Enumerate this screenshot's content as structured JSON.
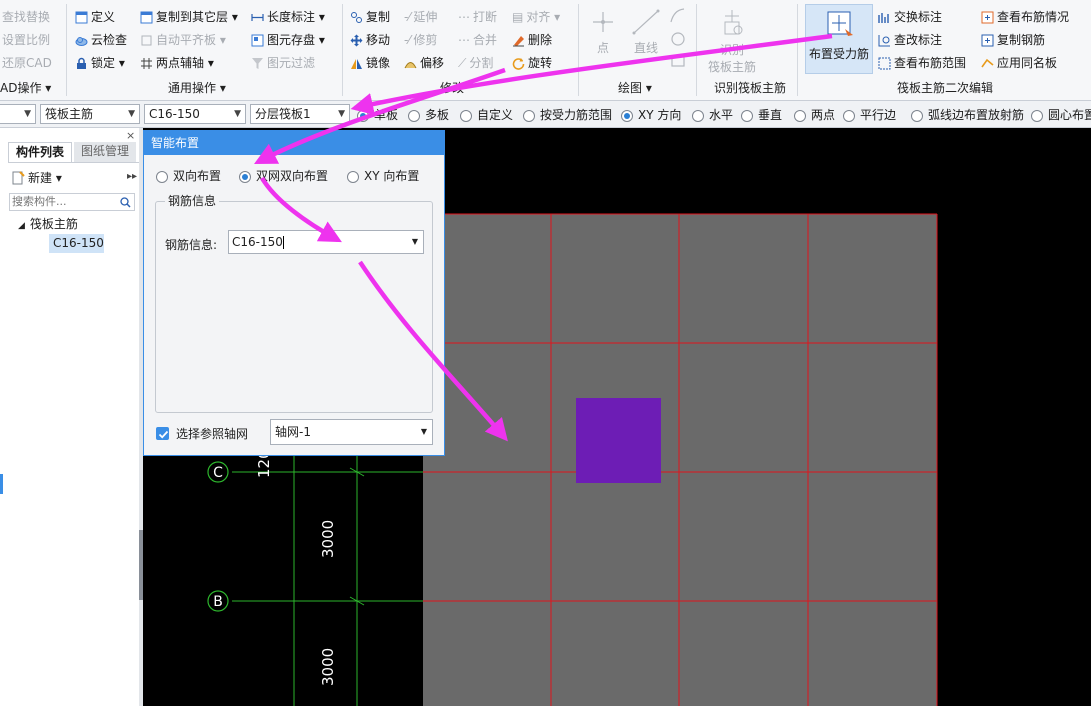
{
  "ribbon": {
    "col0": [
      "查找替换",
      "设置比例",
      "还原CAD"
    ],
    "col0_group": "AD操作",
    "col1": [
      "定义",
      "云检查",
      "锁定"
    ],
    "col2": [
      "复制到其它层",
      "自动平齐板",
      "两点辅轴"
    ],
    "col3": [
      "长度标注",
      "图元存盘",
      "图元过滤"
    ],
    "general_group": "通用操作",
    "col4": [
      "复制",
      "移动",
      "镜像"
    ],
    "col5": [
      "延伸",
      "修剪",
      "偏移"
    ],
    "col6": [
      "打断",
      "合并",
      "分割"
    ],
    "col7": [
      "对齐",
      "删除",
      "旋转"
    ],
    "modify_group": "修改",
    "draw_point": "点",
    "draw_line": "直线",
    "draw_group": "绘图",
    "identify_btn": [
      "识别",
      "筏板主筋"
    ],
    "identify_group": "识别筏板主筋",
    "place_rebar": "布置受力筋",
    "col8": [
      "交换标注",
      "查改标注",
      "查看布筋范围"
    ],
    "col9": [
      "查看布筋情况",
      "复制钢筋",
      "应用同名板"
    ],
    "secondary_group": "筏板主筋二次编辑"
  },
  "toolbar2": {
    "combo1": "",
    "combo2": "筏板主筋",
    "combo3": "C16-150",
    "combo4": "分层筏板1",
    "options": [
      {
        "label": "单板",
        "on": true
      },
      {
        "label": "多板",
        "on": false
      },
      {
        "label": "自定义",
        "on": false
      },
      {
        "label": "按受力筋范围",
        "on": false
      },
      {
        "label": "XY 方向",
        "on": true
      },
      {
        "label": "水平",
        "on": false
      },
      {
        "label": "垂直",
        "on": false
      },
      {
        "label": "两点",
        "on": false
      },
      {
        "label": "平行边",
        "on": false
      },
      {
        "label": "弧线边布置放射筋",
        "on": false
      },
      {
        "label": "圆心布置",
        "on": false
      }
    ]
  },
  "leftpanel": {
    "tab_components": "构件列表",
    "tab_drawings": "图纸管理",
    "new_button": "新建",
    "search_placeholder": "搜索构件...",
    "tree_root": "筏板主筋",
    "tree_child": "C16-150"
  },
  "dialog": {
    "title": "智能布置",
    "radios": [
      {
        "label": "双向布置",
        "on": false
      },
      {
        "label": "双网双向布置",
        "on": true
      },
      {
        "label": "XY 向布置",
        "on": false
      }
    ],
    "group_title": "钢筋信息",
    "field_label": "钢筋信息:",
    "field_value": "C16-150",
    "checkbox_label": "选择参照轴网",
    "checkbox_checked": true,
    "grid_select": "轴网-1"
  },
  "canvas": {
    "axis_c": "C",
    "axis_b": "B",
    "dim_1200": "1200",
    "dim_3000_top": "3000",
    "dim_3000_bottom": "3000",
    "slab_color": "#6a6a6a",
    "grid_line_color": "#e0141c",
    "axis_line_color": "#2db52d",
    "highlight_color": "#6d1db5",
    "arrow_color": "#ee33ee"
  }
}
